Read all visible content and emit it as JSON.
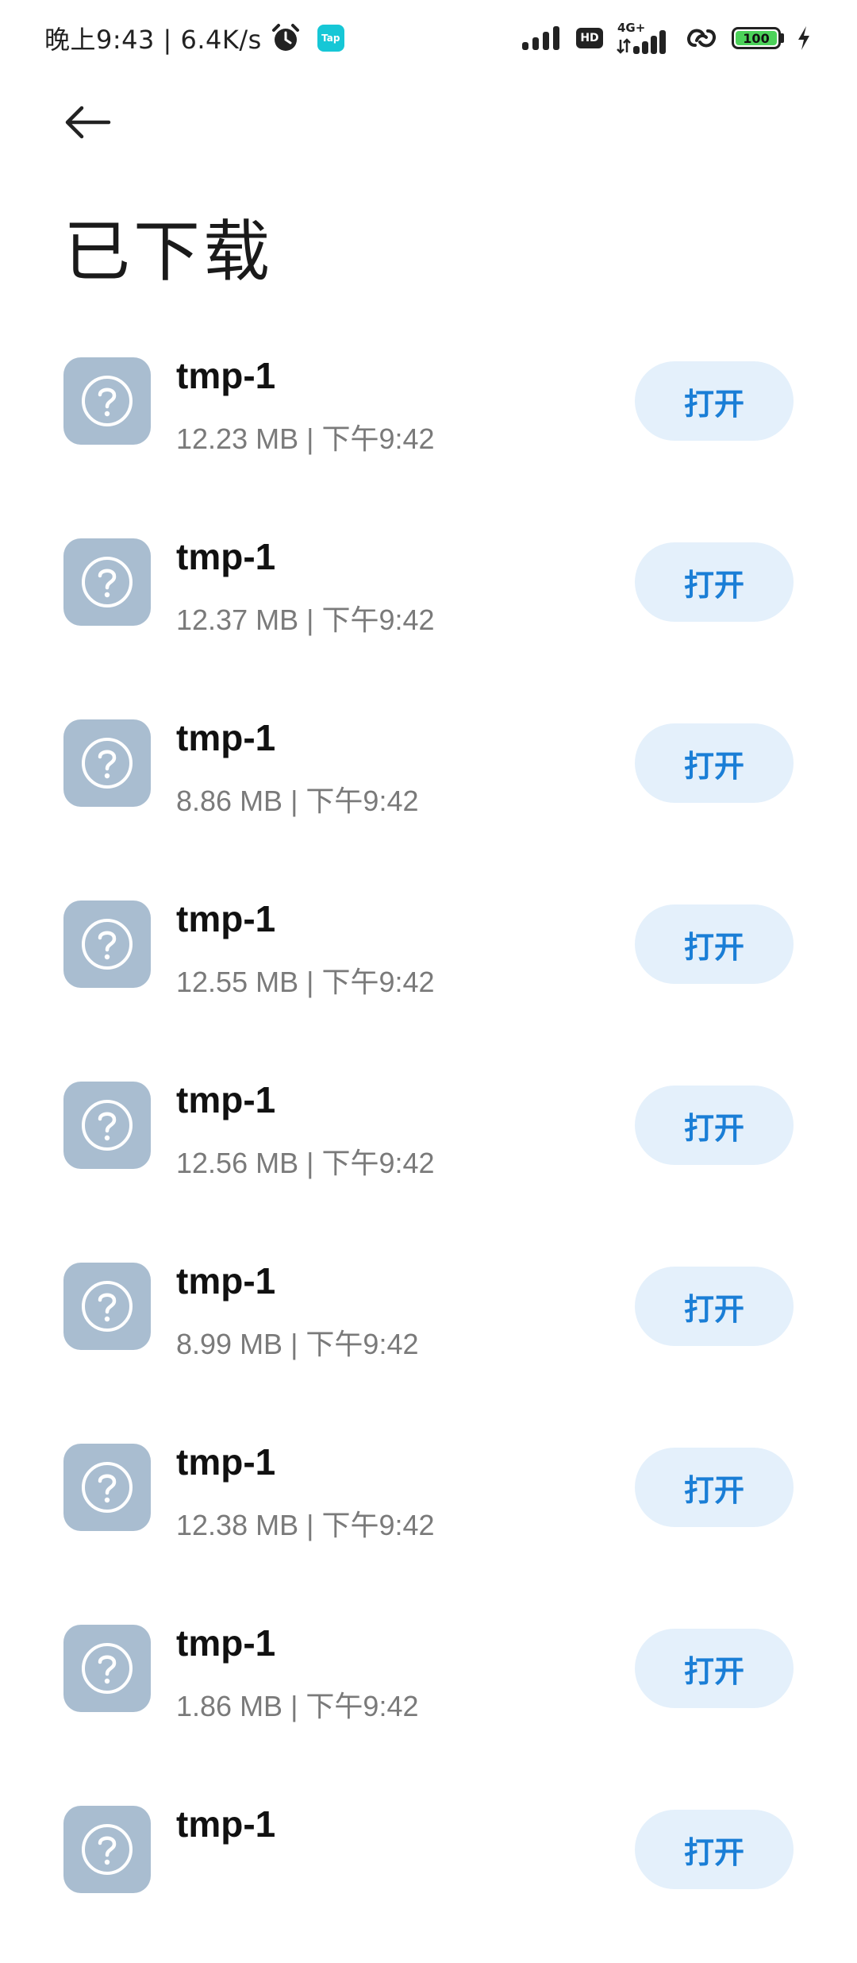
{
  "status_bar": {
    "time_speed": "晚上9:43 | 6.4K/s",
    "tap_badge": "Tap",
    "hd_label": "HD",
    "network_label": "4G+",
    "battery_level": "100",
    "icons": [
      "alarm-icon",
      "tap-app-icon",
      "signal-icon",
      "hd-icon",
      "4g-signal-icon",
      "link-icon",
      "battery-icon",
      "charging-bolt-icon"
    ]
  },
  "header": {
    "back_icon": "back-arrow-icon",
    "title": "已下载"
  },
  "downloads": [
    {
      "name": "tmp-1",
      "meta": "12.23 MB | 下午9:42",
      "action": "打开"
    },
    {
      "name": "tmp-1",
      "meta": "12.37 MB | 下午9:42",
      "action": "打开"
    },
    {
      "name": "tmp-1",
      "meta": "8.86 MB | 下午9:42",
      "action": "打开"
    },
    {
      "name": "tmp-1",
      "meta": "12.55 MB | 下午9:42",
      "action": "打开"
    },
    {
      "name": "tmp-1",
      "meta": "12.56 MB | 下午9:42",
      "action": "打开"
    },
    {
      "name": "tmp-1",
      "meta": "8.99 MB | 下午9:42",
      "action": "打开"
    },
    {
      "name": "tmp-1",
      "meta": "12.38 MB | 下午9:42",
      "action": "打开"
    },
    {
      "name": "tmp-1",
      "meta": "1.86 MB | 下午9:42",
      "action": "打开"
    },
    {
      "name": "tmp-1",
      "meta": "",
      "action": "打开"
    }
  ],
  "colors": {
    "accent": "#1a7ed6",
    "button_bg": "#e4f0fb",
    "file_icon_bg": "#a9bdd0",
    "battery_fill": "#4cd25a"
  }
}
